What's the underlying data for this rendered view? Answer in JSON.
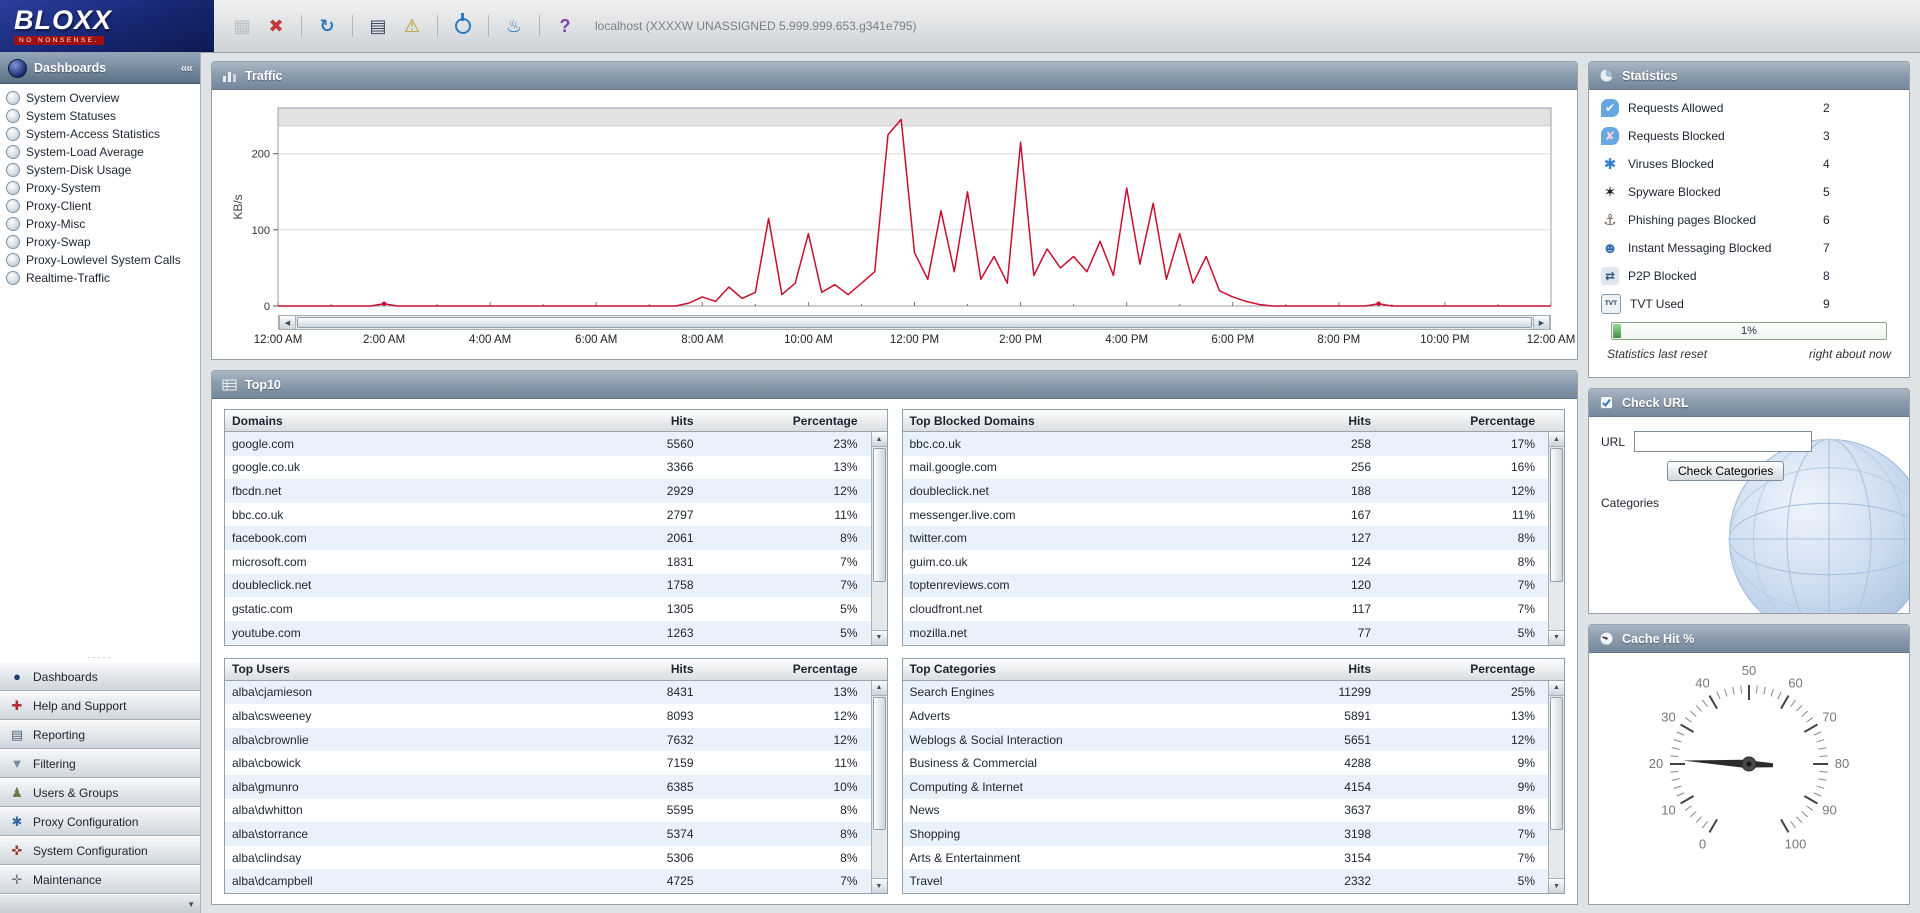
{
  "app": {
    "logo": "BLOXX",
    "tagline": "NO NONSENSE.",
    "host_info": "localhost (XXXXW UNASSIGNED 5.999.999.653.g341e795)"
  },
  "toolbar": {
    "icons": [
      {
        "name": "save-icon",
        "glyph": "▦",
        "color": "#8a8f94",
        "disabled": true
      },
      {
        "name": "delete-icon",
        "glyph": "✖",
        "color": "#c23b3b",
        "disabled": false
      },
      {
        "name": "refresh-icon",
        "glyph": "↻",
        "color": "#2a7bc0",
        "disabled": false
      },
      {
        "name": "report-icon",
        "glyph": "▤",
        "color": "#3a4a66",
        "disabled": false
      },
      {
        "name": "alert-icon",
        "glyph": "⚠",
        "color": "#b8961f",
        "disabled": false
      },
      {
        "name": "power-icon",
        "glyph": "",
        "color": "#2a7bc0",
        "disabled": false,
        "power": true
      },
      {
        "name": "magic-lamp-icon",
        "glyph": "♨",
        "color": "#2a7bc0",
        "disabled": false
      },
      {
        "name": "help-icon",
        "glyph": "?",
        "color": "#7a3fa8",
        "disabled": false
      }
    ]
  },
  "sidebar": {
    "title": "Dashboards",
    "collapse_glyph": "««",
    "separator_glyph": "·····",
    "chevron_down_glyph": "▼",
    "items": [
      "System Overview",
      "System Statuses",
      "System-Access Statistics",
      "System-Load Average",
      "System-Disk Usage",
      "Proxy-System",
      "Proxy-Client",
      "Proxy-Misc",
      "Proxy-Swap",
      "Proxy-Lowlevel System Calls",
      "Realtime-Traffic"
    ],
    "accordion": [
      {
        "label": "Dashboards",
        "icon": "dashboards-icon",
        "glyph": "●",
        "color": "#1d3f77"
      },
      {
        "label": "Help and Support",
        "icon": "help-support-icon",
        "glyph": "✚",
        "color": "#b03030"
      },
      {
        "label": "Reporting",
        "icon": "reporting-icon",
        "glyph": "▤",
        "color": "#55657a"
      },
      {
        "label": "Filtering",
        "icon": "filtering-icon",
        "glyph": "▼",
        "color": "#7b8ba0"
      },
      {
        "label": "Users & Groups",
        "icon": "users-groups-icon",
        "glyph": "♟",
        "color": "#6b7d46"
      },
      {
        "label": "Proxy Configuration",
        "icon": "proxy-config-icon",
        "glyph": "✱",
        "color": "#35699f"
      },
      {
        "label": "System Configuration",
        "icon": "system-config-icon",
        "glyph": "✜",
        "color": "#a03636"
      },
      {
        "label": "Maintenance",
        "icon": "maintenance-icon",
        "glyph": "✛",
        "color": "#6a7480"
      }
    ]
  },
  "traffic": {
    "title": "Traffic",
    "scroll_left_glyph": "◀",
    "scroll_right_glyph": "▶"
  },
  "top10": {
    "title": "Top10",
    "hits_header": "Hits",
    "percentage_header": "Percentage",
    "scroll_up_glyph": "▲",
    "scroll_down_glyph": "▼",
    "tables": [
      {
        "name_header": "Domains",
        "rows": [
          [
            "google.com",
            5560,
            "23%"
          ],
          [
            "google.co.uk",
            3366,
            "13%"
          ],
          [
            "fbcdn.net",
            2929,
            "12%"
          ],
          [
            "bbc.co.uk",
            2797,
            "11%"
          ],
          [
            "facebook.com",
            2061,
            "8%"
          ],
          [
            "microsoft.com",
            1831,
            "7%"
          ],
          [
            "doubleclick.net",
            1758,
            "7%"
          ],
          [
            "gstatic.com",
            1305,
            "5%"
          ],
          [
            "youtube.com",
            1263,
            "5%"
          ]
        ]
      },
      {
        "name_header": "Top Blocked Domains",
        "rows": [
          [
            "bbc.co.uk",
            258,
            "17%"
          ],
          [
            "mail.google.com",
            256,
            "16%"
          ],
          [
            "doubleclick.net",
            188,
            "12%"
          ],
          [
            "messenger.live.com",
            167,
            "11%"
          ],
          [
            "twitter.com",
            127,
            "8%"
          ],
          [
            "guim.co.uk",
            124,
            "8%"
          ],
          [
            "toptenreviews.com",
            120,
            "7%"
          ],
          [
            "cloudfront.net",
            117,
            "7%"
          ],
          [
            "mozilla.net",
            77,
            "5%"
          ]
        ]
      },
      {
        "name_header": "Top Users",
        "rows": [
          [
            "alba\\cjamieson",
            8431,
            "13%"
          ],
          [
            "alba\\csweeney",
            8093,
            "12%"
          ],
          [
            "alba\\cbrownlie",
            7632,
            "12%"
          ],
          [
            "alba\\cbowick",
            7159,
            "11%"
          ],
          [
            "alba\\gmunro",
            6385,
            "10%"
          ],
          [
            "alba\\dwhitton",
            5595,
            "8%"
          ],
          [
            "alba\\storrance",
            5374,
            "8%"
          ],
          [
            "alba\\clindsay",
            5306,
            "8%"
          ],
          [
            "alba\\dcampbell",
            4725,
            "7%"
          ]
        ]
      },
      {
        "name_header": "Top Categories",
        "rows": [
          [
            "Search Engines",
            11299,
            "25%"
          ],
          [
            "Adverts",
            5891,
            "13%"
          ],
          [
            "Weblogs & Social Interaction",
            5651,
            "12%"
          ],
          [
            "Business & Commercial",
            4288,
            "9%"
          ],
          [
            "Computing & Internet",
            4154,
            "9%"
          ],
          [
            "News",
            3637,
            "8%"
          ],
          [
            "Shopping",
            3198,
            "7%"
          ],
          [
            "Arts & Entertainment",
            3154,
            "7%"
          ],
          [
            "Travel",
            2332,
            "5%"
          ]
        ]
      }
    ]
  },
  "statistics": {
    "title": "Statistics",
    "rows": [
      {
        "icon": "requests-allowed-icon",
        "glyph": "✔",
        "bg": "#66a8e0",
        "fg": "#ffffff",
        "label": "Requests Allowed",
        "value": "2"
      },
      {
        "icon": "requests-blocked-icon",
        "glyph": "✘",
        "bg": "#66a8e0",
        "fg": "#ffd6d6",
        "label": "Requests Blocked",
        "value": "3"
      },
      {
        "icon": "viruses-blocked-icon",
        "glyph": "✱",
        "bg": "transparent",
        "fg": "#2a7fd4",
        "label": "Viruses Blocked",
        "value": "4"
      },
      {
        "icon": "spyware-blocked-icon",
        "glyph": "✶",
        "bg": "transparent",
        "fg": "#222222",
        "label": "Spyware Blocked",
        "value": "5"
      },
      {
        "icon": "phishing-blocked-icon",
        "glyph": "⚓",
        "bg": "transparent",
        "fg": "#77654a",
        "label": "Phishing pages Blocked",
        "value": "6"
      },
      {
        "icon": "im-blocked-icon",
        "glyph": "☻",
        "bg": "transparent",
        "fg": "#3a6fb0",
        "label": "Instant Messaging Blocked",
        "value": "7"
      },
      {
        "icon": "p2p-blocked-icon",
        "glyph": "⇄",
        "bg": "#dfe8f2",
        "fg": "#35597e",
        "label": "P2P Blocked",
        "value": "8"
      },
      {
        "icon": "tvt-used-icon",
        "glyph": "TVT",
        "bg": "#eef3f8",
        "fg": "#223a55",
        "label": "TVT Used",
        "value": "9"
      }
    ],
    "progress_label": "1%",
    "progress_percent": 1,
    "footer_left": "Statistics last reset",
    "footer_right": "right about now"
  },
  "check_url": {
    "title": "Check URL",
    "url_label": "URL",
    "url_value": "",
    "button_label": "Check Categories",
    "categories_label": "Categories"
  },
  "cache": {
    "title": "Cache Hit %"
  },
  "chart_data": [
    {
      "type": "line",
      "title": "Traffic",
      "xlabel": "",
      "ylabel": "KB/s",
      "ylim": [
        0,
        260
      ],
      "yticks": [
        0,
        100,
        200
      ],
      "xlim_hours": [
        0,
        24
      ],
      "x_start_hour": 0,
      "x_step_hours": 0.25,
      "xtick_labels": [
        "12:00 AM",
        "2:00 AM",
        "4:00 AM",
        "6:00 AM",
        "8:00 AM",
        "10:00 AM",
        "12:00 PM",
        "2:00 PM",
        "4:00 PM",
        "6:00 PM",
        "8:00 PM",
        "10:00 PM",
        "12:00 AM"
      ],
      "grid": "horizontal",
      "series": [
        {
          "name": "Traffic KB/s",
          "color": "#c8102e",
          "y": [
            0,
            0,
            0,
            0,
            0,
            0,
            0,
            0,
            3,
            0,
            0,
            0,
            0,
            0,
            0,
            0,
            0,
            0,
            0,
            0,
            0,
            0,
            0,
            0,
            0,
            0,
            0,
            0,
            0,
            0,
            0,
            4,
            12,
            6,
            25,
            10,
            18,
            115,
            15,
            30,
            95,
            18,
            28,
            15,
            30,
            45,
            225,
            245,
            70,
            35,
            125,
            45,
            150,
            35,
            65,
            30,
            215,
            40,
            75,
            50,
            65,
            45,
            85,
            40,
            155,
            55,
            135,
            35,
            95,
            30,
            65,
            20,
            12,
            6,
            2,
            0,
            0,
            0,
            0,
            0,
            0,
            0,
            0,
            3,
            0,
            0,
            0,
            0,
            0,
            0,
            0,
            0,
            0,
            0,
            0,
            0,
            0
          ]
        }
      ]
    },
    {
      "type": "gauge",
      "title": "Cache Hit %",
      "min": 0,
      "max": 100,
      "major_tick_step": 10,
      "tick_labels": [
        "0",
        "10",
        "20",
        "30",
        "40",
        "50",
        "60",
        "70",
        "80",
        "90",
        "100"
      ],
      "value": 21,
      "needle_color": "#2b2b2b"
    }
  ]
}
